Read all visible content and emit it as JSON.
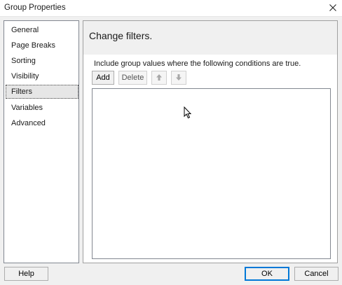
{
  "window": {
    "title": "Group Properties",
    "close_icon": "close-icon"
  },
  "sidebar": {
    "items": [
      {
        "label": "General",
        "selected": false
      },
      {
        "label": "Page Breaks",
        "selected": false
      },
      {
        "label": "Sorting",
        "selected": false
      },
      {
        "label": "Visibility",
        "selected": false
      },
      {
        "label": "Filters",
        "selected": true
      },
      {
        "label": "Variables",
        "selected": false
      },
      {
        "label": "Advanced",
        "selected": false
      }
    ]
  },
  "main": {
    "heading": "Change filters.",
    "instruction": "Include group values where the following conditions are true.",
    "toolbar": {
      "add_label": "Add",
      "delete_label": "Delete",
      "move_up_icon": "arrow-up-icon",
      "move_down_icon": "arrow-down-icon"
    },
    "filters": []
  },
  "footer": {
    "help_label": "Help",
    "ok_label": "OK",
    "cancel_label": "Cancel"
  },
  "colors": {
    "focus_border": "#0078d7",
    "selected_bg": "#e6e6e6",
    "dialog_bg": "#f0f0f0"
  }
}
